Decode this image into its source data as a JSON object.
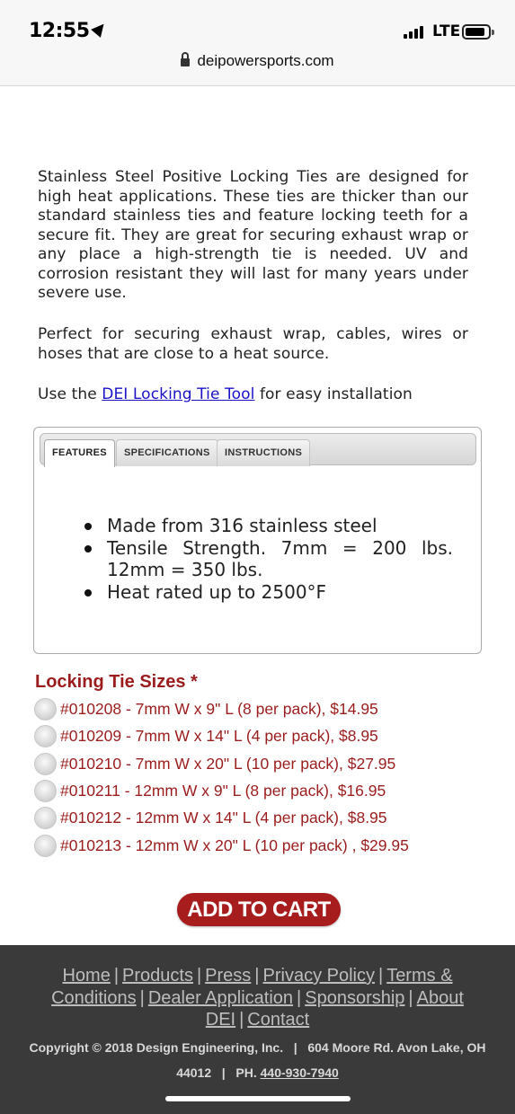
{
  "status_bar": {
    "time": "12:55",
    "network": "LTE",
    "url": "deipowersports.com"
  },
  "description": {
    "paragraph1": "Stainless Steel Positive Locking Ties are designed for high heat applications. These ties are thicker than our standard stainless ties and feature locking teeth for a secure fit. They are great for securing exhaust wrap or any place a high-strength tie is needed. UV and corrosion resistant they will last for many years under severe use.",
    "paragraph2": "Perfect for securing exhaust wrap, cables, wires or hoses that are close to a heat source.",
    "tool_prefix": "Use the ",
    "tool_link": "DEI Locking Tie Tool",
    "tool_suffix": " for easy installation"
  },
  "tabs": [
    {
      "label": "FEATURES",
      "active": true
    },
    {
      "label": "SPECIFICATIONS",
      "active": false
    },
    {
      "label": "INSTRUCTIONS",
      "active": false
    }
  ],
  "features": [
    "Made from 316 stainless steel",
    "Tensile Strength. 7mm = 200 lbs. 12mm = 350 lbs.",
    "Heat rated up to 2500°F"
  ],
  "sizes": {
    "title": "Locking Tie Sizes *",
    "options": [
      "#010208 - 7mm W x 9\" L (8 per pack), $14.95",
      "#010209 - 7mm W x 14\" L (4 per pack), $8.95",
      "#010210 - 7mm W x 20\" L (10 per pack), $27.95",
      "#010211 - 12mm W x 9\" L (8 per pack), $16.95",
      "#010212 - 12mm W x 14\" L (4 per pack), $8.95",
      "#010213 - 12mm W x 20\" L (10 per pack) , $29.95"
    ]
  },
  "add_to_cart": "ADD TO CART",
  "footer": {
    "links": [
      "Home",
      "Products",
      "Press",
      "Privacy Policy",
      "Terms & Conditions",
      "Dealer Application",
      "Sponsorship",
      "About DEI",
      "Contact"
    ],
    "copyright": "Copyright © 2018 Design Engineering, Inc.",
    "address": "604 Moore Rd. Avon Lake, OH 44012",
    "phone_prefix": "PH.",
    "phone": "440-930-7940"
  },
  "colors": {
    "accent": "#a71d1d",
    "size_text": "#9b1c1c",
    "link": "#1a12c8",
    "footer_bg": "#3a3a3a"
  }
}
